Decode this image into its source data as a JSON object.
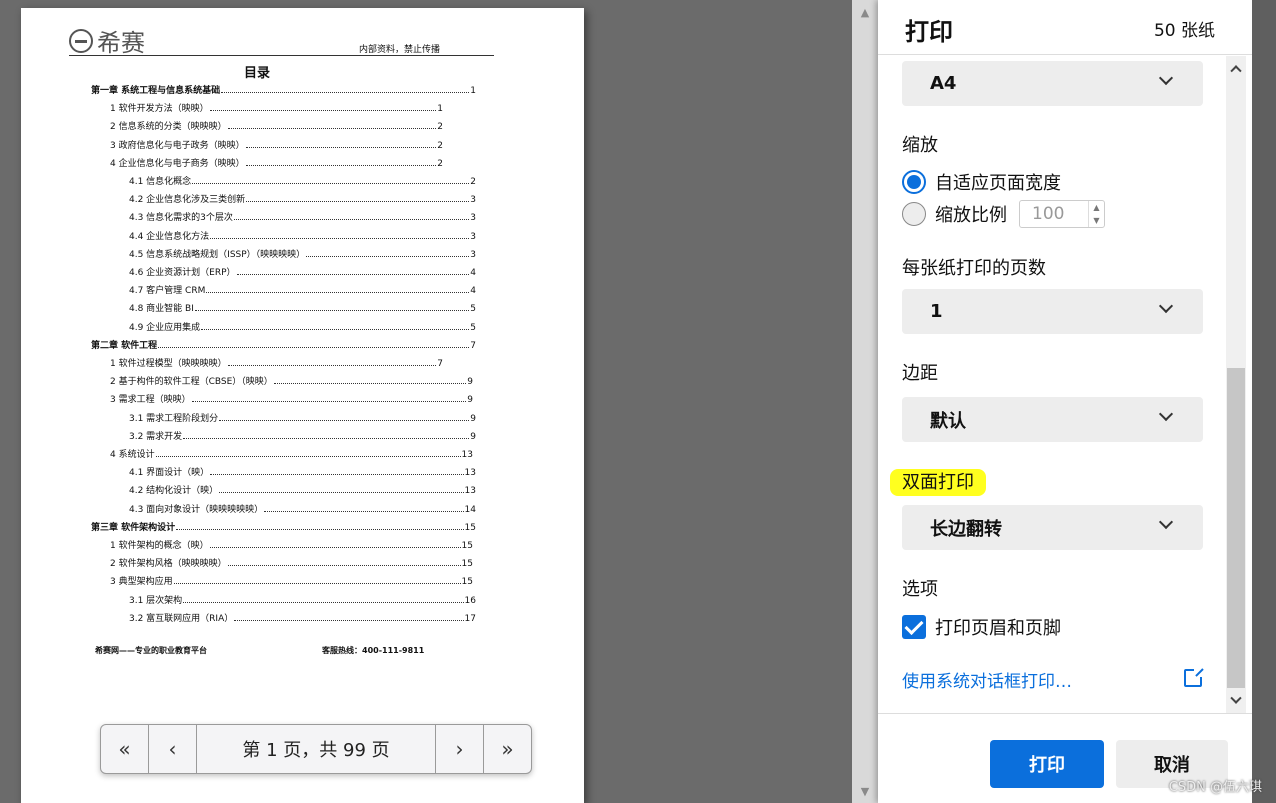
{
  "document": {
    "logo_text": "希赛",
    "notice": "内部资料，禁止传播",
    "title": "目录",
    "toc": [
      {
        "level": 1,
        "text": "第一章 系统工程与信息系统基础",
        "page": "1"
      },
      {
        "level": 2,
        "text": "1 软件开发方法（映映）",
        "page": "1"
      },
      {
        "level": 2,
        "text": "2 信息系统的分类（映映映）",
        "page": "2"
      },
      {
        "level": 2,
        "text": "3 政府信息化与电子政务（映映）",
        "page": "2"
      },
      {
        "level": 2,
        "text": "4 企业信息化与电子商务（映映）",
        "page": "2"
      },
      {
        "level": 3,
        "text": "4.1 信息化概念",
        "page": "2"
      },
      {
        "level": 3,
        "text": "4.2 企业信息化涉及三类创新",
        "page": "3"
      },
      {
        "level": 3,
        "text": "4.3 信息化需求的3个层次",
        "page": "3"
      },
      {
        "level": 3,
        "text": "4.4 企业信息化方法",
        "page": "3"
      },
      {
        "level": 3,
        "text": "4.5 信息系统战略规划（ISSP）（映映映映）",
        "page": "3"
      },
      {
        "level": 3,
        "text": "4.6 企业资源计划（ERP）",
        "page": "4"
      },
      {
        "level": 3,
        "text": "4.7 客户管理 CRM",
        "page": "4"
      },
      {
        "level": 3,
        "text": "4.8 商业智能 BI",
        "page": "5"
      },
      {
        "level": 3,
        "text": "4.9 企业应用集成",
        "page": "5"
      },
      {
        "level": 1,
        "text": "第二章 软件工程",
        "page": "7"
      },
      {
        "level": 2,
        "text": "1 软件过程模型（映映映映）",
        "page": "7"
      },
      {
        "level": 2,
        "text": "2 基于构件的软件工程（CBSE）（映映）",
        "page": "9"
      },
      {
        "level": 2,
        "text": "3 需求工程（映映）",
        "page": "9"
      },
      {
        "level": 3,
        "text": "3.1 需求工程阶段划分",
        "page": "9"
      },
      {
        "level": 3,
        "text": "3.2 需求开发",
        "page": "9"
      },
      {
        "level": 2,
        "text": "4 系统设计",
        "page": "13"
      },
      {
        "level": 3,
        "text": "4.1 界面设计（映）",
        "page": "13"
      },
      {
        "level": 3,
        "text": "4.2 结构化设计（映）",
        "page": "13"
      },
      {
        "level": 3,
        "text": "4.3 面向对象设计（映映映映映）",
        "page": "14"
      },
      {
        "level": 1,
        "text": "第三章 软件架构设计",
        "page": "15"
      },
      {
        "level": 2,
        "text": "1 软件架构的概念（映）",
        "page": "15"
      },
      {
        "level": 2,
        "text": "2 软件架构风格（映映映映）",
        "page": "15"
      },
      {
        "level": 2,
        "text": "3 典型架构应用",
        "page": "15"
      },
      {
        "level": 3,
        "text": "3.1 层次架构",
        "page": "16"
      },
      {
        "level": 3,
        "text": "3.2 富互联网应用（RIA）",
        "page": "17"
      }
    ],
    "footer_left": "希赛网——专业的职业教育平台",
    "footer_right": "客服热线：400-111-9811"
  },
  "pager": {
    "first": "«",
    "prev": "‹",
    "label": "第 1 页，共 99 页",
    "next": "›",
    "last": "»"
  },
  "dialog": {
    "title": "打印",
    "sheet_count": "50 张纸",
    "paper_size": "A4",
    "scale_label": "缩放",
    "scale_fit_label": "自适应页面宽度",
    "scale_custom_label": "缩放比例",
    "scale_value": "100",
    "pages_per_sheet_label": "每张纸打印的页数",
    "pages_per_sheet_value": "1",
    "margins_label": "边距",
    "margins_value": "默认",
    "duplex_label": "双面打印",
    "duplex_value": "长边翻转",
    "options_label": "选项",
    "headers_footers_label": "打印页眉和页脚",
    "system_dialog_link": "使用系统对话框打印…",
    "print_button": "打印",
    "cancel_button": "取消"
  },
  "watermark": "CSDN @伍六琪",
  "colors": {
    "accent": "#0b6fdc",
    "highlight": "#ffff1f",
    "backdrop": "#6b6b6b"
  }
}
